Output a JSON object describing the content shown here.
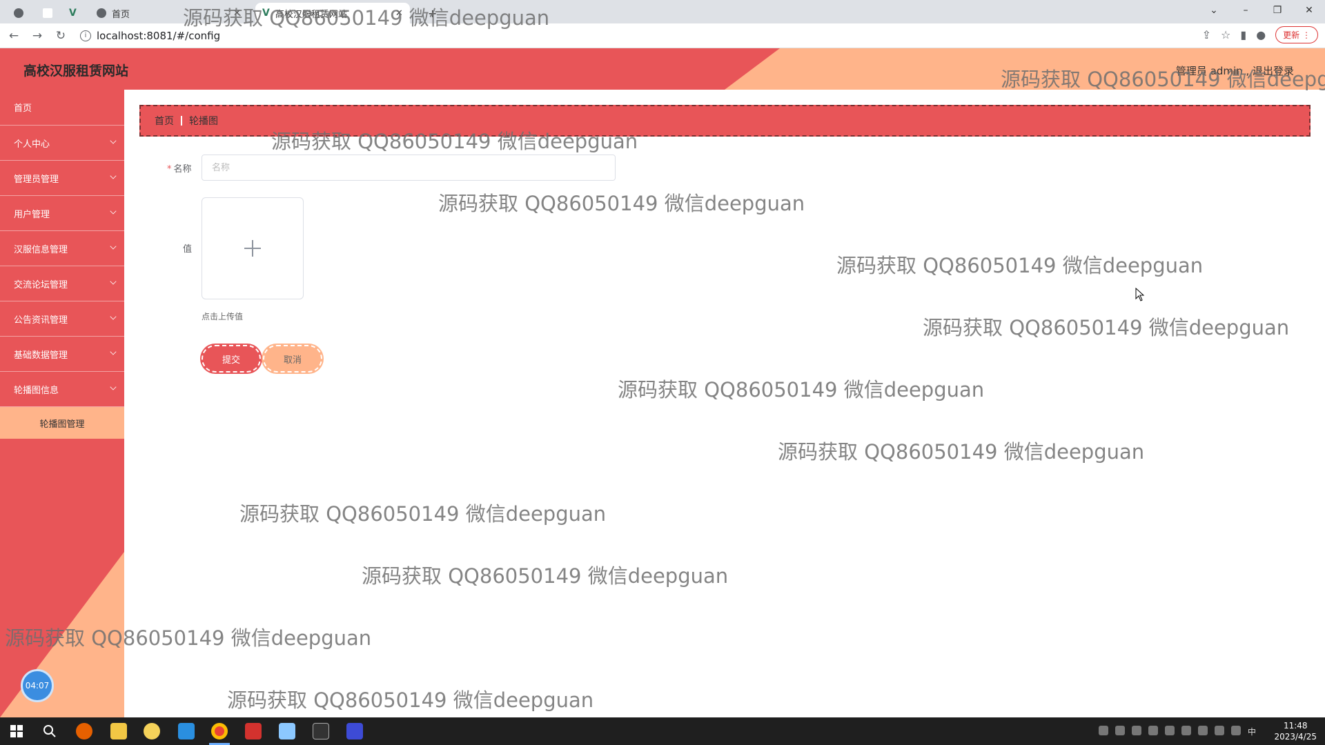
{
  "browser": {
    "tabs": [
      {
        "label": "首页",
        "icon": "globe-icon"
      },
      {
        "label": "高校汉服租赁网站",
        "icon": "vue-icon"
      }
    ],
    "new_tab": "+",
    "url": "localhost:8081/#/config",
    "update_label": "更新"
  },
  "header": {
    "title": "高校汉服租赁网站",
    "user_info": "管理员 admin , 退出登录"
  },
  "sidebar": {
    "items": [
      {
        "label": "首页"
      },
      {
        "label": "个人中心"
      },
      {
        "label": "管理员管理"
      },
      {
        "label": "用户管理"
      },
      {
        "label": "汉服信息管理"
      },
      {
        "label": "交流论坛管理"
      },
      {
        "label": "公告资讯管理"
      },
      {
        "label": "基础数据管理"
      },
      {
        "label": "轮播图信息"
      }
    ],
    "submenu": {
      "label": "轮播图管理"
    },
    "timer": "04:07"
  },
  "breadcrumb": {
    "home": "首页",
    "current": "轮播图"
  },
  "form": {
    "name_label": "名称",
    "name_placeholder": "名称",
    "value_label": "值",
    "upload_tip": "点击上传值",
    "submit_label": "提交",
    "cancel_label": "取消"
  },
  "watermark": "源码获取 QQ86050149 微信deepguan",
  "taskbar": {
    "time": "11:48",
    "date": "2023/4/25",
    "ime": "中"
  },
  "colors": {
    "primary": "#e85558",
    "accent": "#ffb48a"
  }
}
